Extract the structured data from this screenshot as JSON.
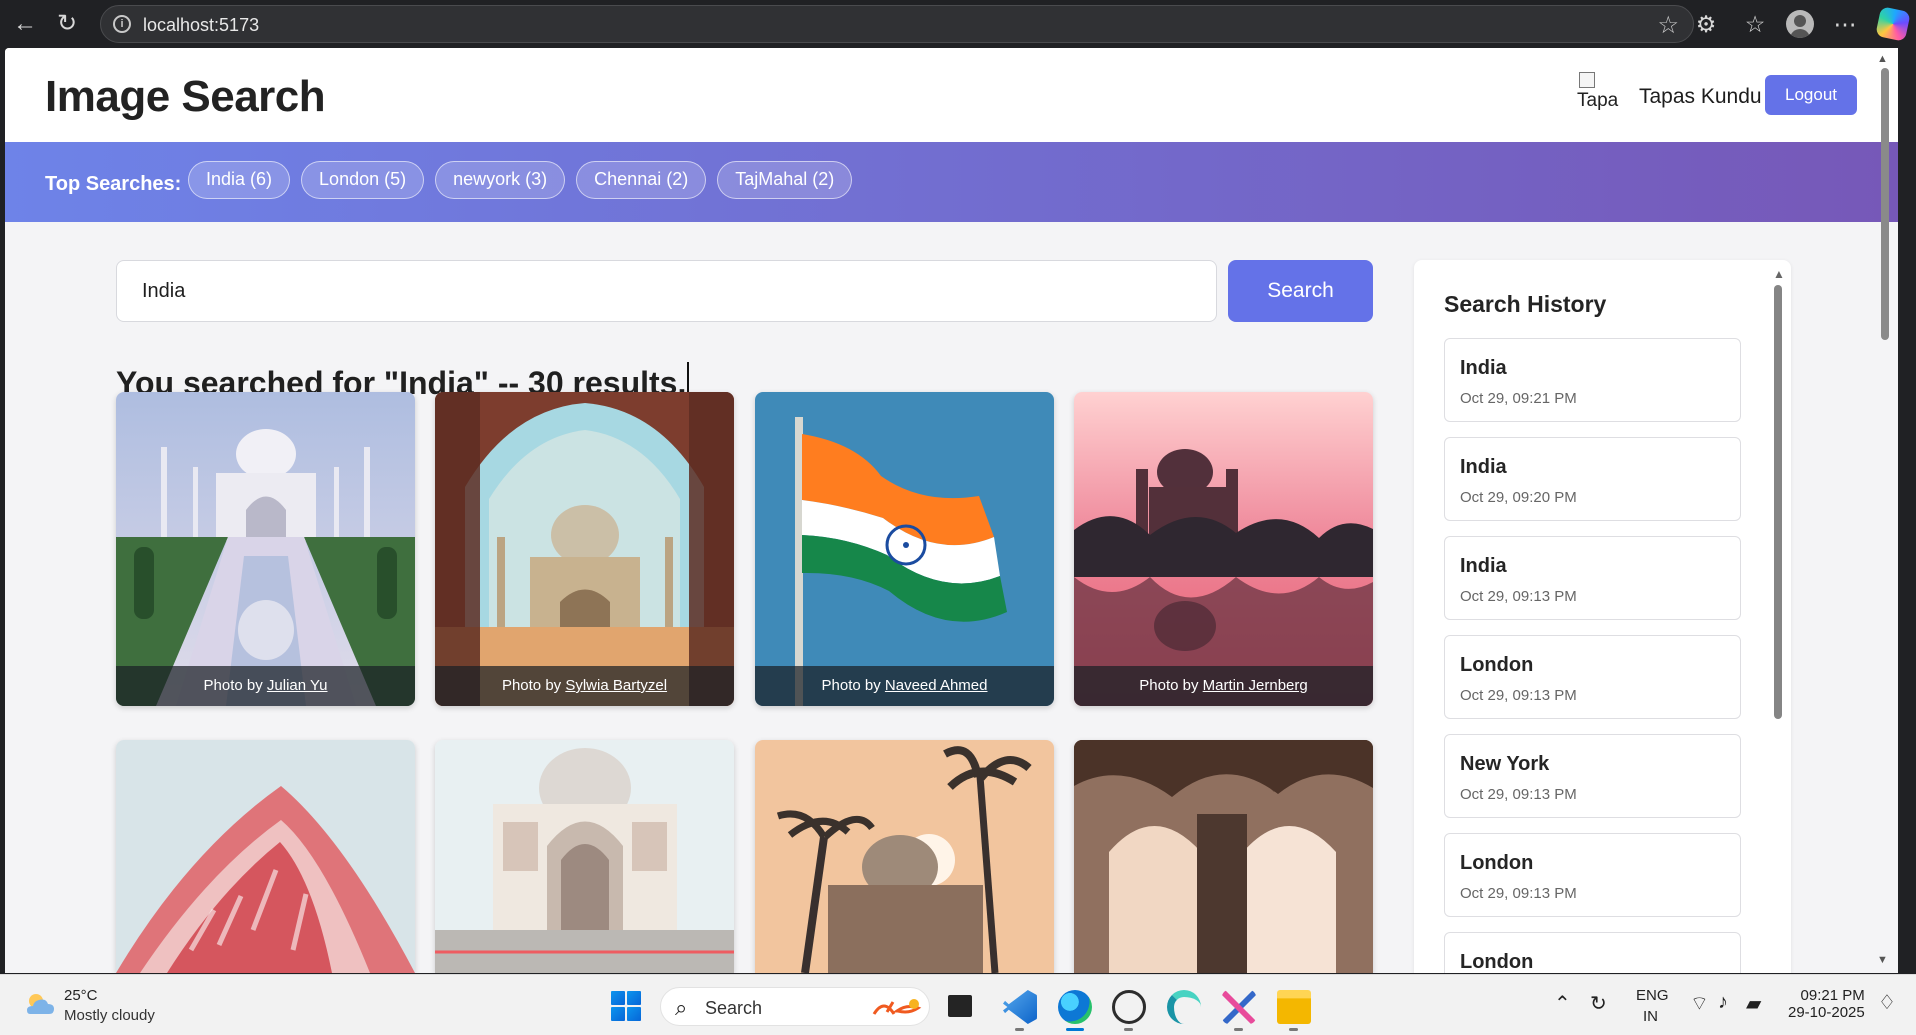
{
  "browser": {
    "address": "localhost:5173",
    "icons": [
      "back-icon",
      "refresh-icon",
      "site-info-icon",
      "favorite-icon",
      "extensions-icon",
      "favorites-icon",
      "profile-icon",
      "more-icon",
      "copilot-icon"
    ]
  },
  "header": {
    "title": "Image Search",
    "avatar_alt": "Tapa",
    "user_name": "Tapas Kundu",
    "logout_label": "Logout"
  },
  "top_searches": {
    "label": "Top Searches:",
    "items": [
      {
        "label": "India (6)"
      },
      {
        "label": "London (5)"
      },
      {
        "label": "newyork (3)"
      },
      {
        "label": "Chennai (2)"
      },
      {
        "label": "TajMahal (2)"
      }
    ]
  },
  "search": {
    "value": "India",
    "button_label": "Search",
    "result_heading": "You searched for \"India\" -- 30 results."
  },
  "results": [
    {
      "credit_prefix": "Photo by ",
      "photographer": "Julian Yu",
      "subject": "taj-mahal-reflection"
    },
    {
      "credit_prefix": "Photo by ",
      "photographer": "Sylwia Bartyzel",
      "subject": "taj-mahal-arch-view"
    },
    {
      "credit_prefix": "Photo by ",
      "photographer": "Naveed Ahmed",
      "subject": "india-flag"
    },
    {
      "credit_prefix": "Photo by ",
      "photographer": "Martin Jernberg",
      "subject": "palace-reflection-sunset"
    },
    {
      "subject": "hawa-mahal"
    },
    {
      "subject": "taj-mahal-front"
    },
    {
      "subject": "monument-palms"
    },
    {
      "subject": "sandstone-arches"
    }
  ],
  "history": {
    "title": "Search History",
    "items": [
      {
        "query": "India",
        "time": "Oct 29, 09:21 PM"
      },
      {
        "query": "India",
        "time": "Oct 29, 09:20 PM"
      },
      {
        "query": "India",
        "time": "Oct 29, 09:13 PM"
      },
      {
        "query": "London",
        "time": "Oct 29, 09:13 PM"
      },
      {
        "query": "New York",
        "time": "Oct 29, 09:13 PM"
      },
      {
        "query": "London",
        "time": "Oct 29, 09:13 PM"
      },
      {
        "query": "London"
      }
    ]
  },
  "taskbar": {
    "weather": {
      "temperature": "25°C",
      "condition": "Mostly cloudy"
    },
    "search_placeholder": "Search",
    "language": "ENG",
    "region": "IN",
    "time": "09:21 PM",
    "date": "29-10-2025",
    "apps": [
      "windows-start-icon",
      "search-icon",
      "file-panel-icon",
      "vscode-icon",
      "edge-icon",
      "chatgpt-icon",
      "wave-app-icon",
      "snipping-tool-icon",
      "file-explorer-icon"
    ]
  },
  "colors": {
    "accent": "#6472E8",
    "gradient_start": "#6E83E8",
    "gradient_end": "#7658B8"
  }
}
